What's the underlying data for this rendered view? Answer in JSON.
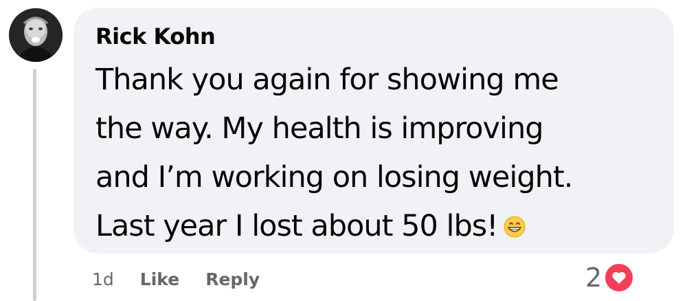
{
  "comment": {
    "author": "Rick Kohn",
    "body_lines": [
      "Thank you again for showing me",
      "the way. My health is improving",
      "and I’m working on losing weight.",
      "Last year I lost about 50 lbs!"
    ],
    "emoji": "grinning-face-icon"
  },
  "actions": {
    "timestamp": "1d",
    "like_label": "Like",
    "reply_label": "Reply"
  },
  "reactions": {
    "count": "2",
    "type": "heart-icon",
    "color": "#f33e58"
  },
  "colors": {
    "bubble": "#f0f2f5",
    "text": "#050505",
    "secondary": "#65676b"
  }
}
